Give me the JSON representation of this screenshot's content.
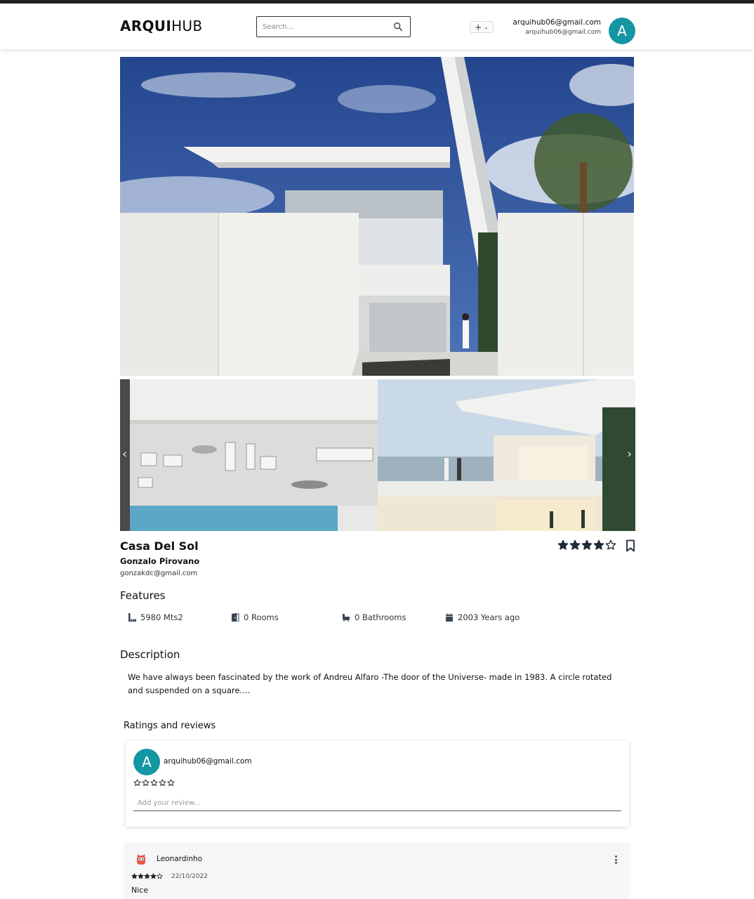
{
  "app": {
    "logo_bold": "ARQUI",
    "logo_light": "HUB"
  },
  "header": {
    "search_placeholder": "Search...",
    "add_label": "+",
    "user_email": "arquihub06@gmail.com",
    "user_sub": "arquihub06@gmail.com",
    "avatar_letter": "A"
  },
  "project": {
    "title": "Casa Del Sol",
    "author": "Gonzalo Pirovano",
    "author_email": "gonzakdc@gmail.com",
    "rating": 4,
    "max_rating": 5
  },
  "features": {
    "heading": "Features",
    "items": [
      {
        "icon": "ruler-icon",
        "label": "5980 Mts2"
      },
      {
        "icon": "door-icon",
        "label": "0 Rooms"
      },
      {
        "icon": "bath-icon",
        "label": "0 Bathrooms"
      },
      {
        "icon": "calendar-icon",
        "label": "2003 Years ago"
      }
    ]
  },
  "description": {
    "heading": "Description",
    "text": "We have always been fascinated by the work of Andreu Alfaro -The door of the Universe- made in 1983. A circle rotated and suspended on a square...."
  },
  "reviews": {
    "heading": "Ratings and reviews",
    "form": {
      "avatar_letter": "A",
      "email": "arquihub06@gmail.com",
      "rating": 0,
      "placeholder": "Add your review..."
    },
    "items": [
      {
        "name": "Leonardinho",
        "rating": 4,
        "date": "22/10/2022",
        "text": "Nice"
      }
    ]
  },
  "colors": {
    "accent": "#1496a3",
    "sky": "#2f4f93",
    "card_bg": "#f5f6f7"
  }
}
